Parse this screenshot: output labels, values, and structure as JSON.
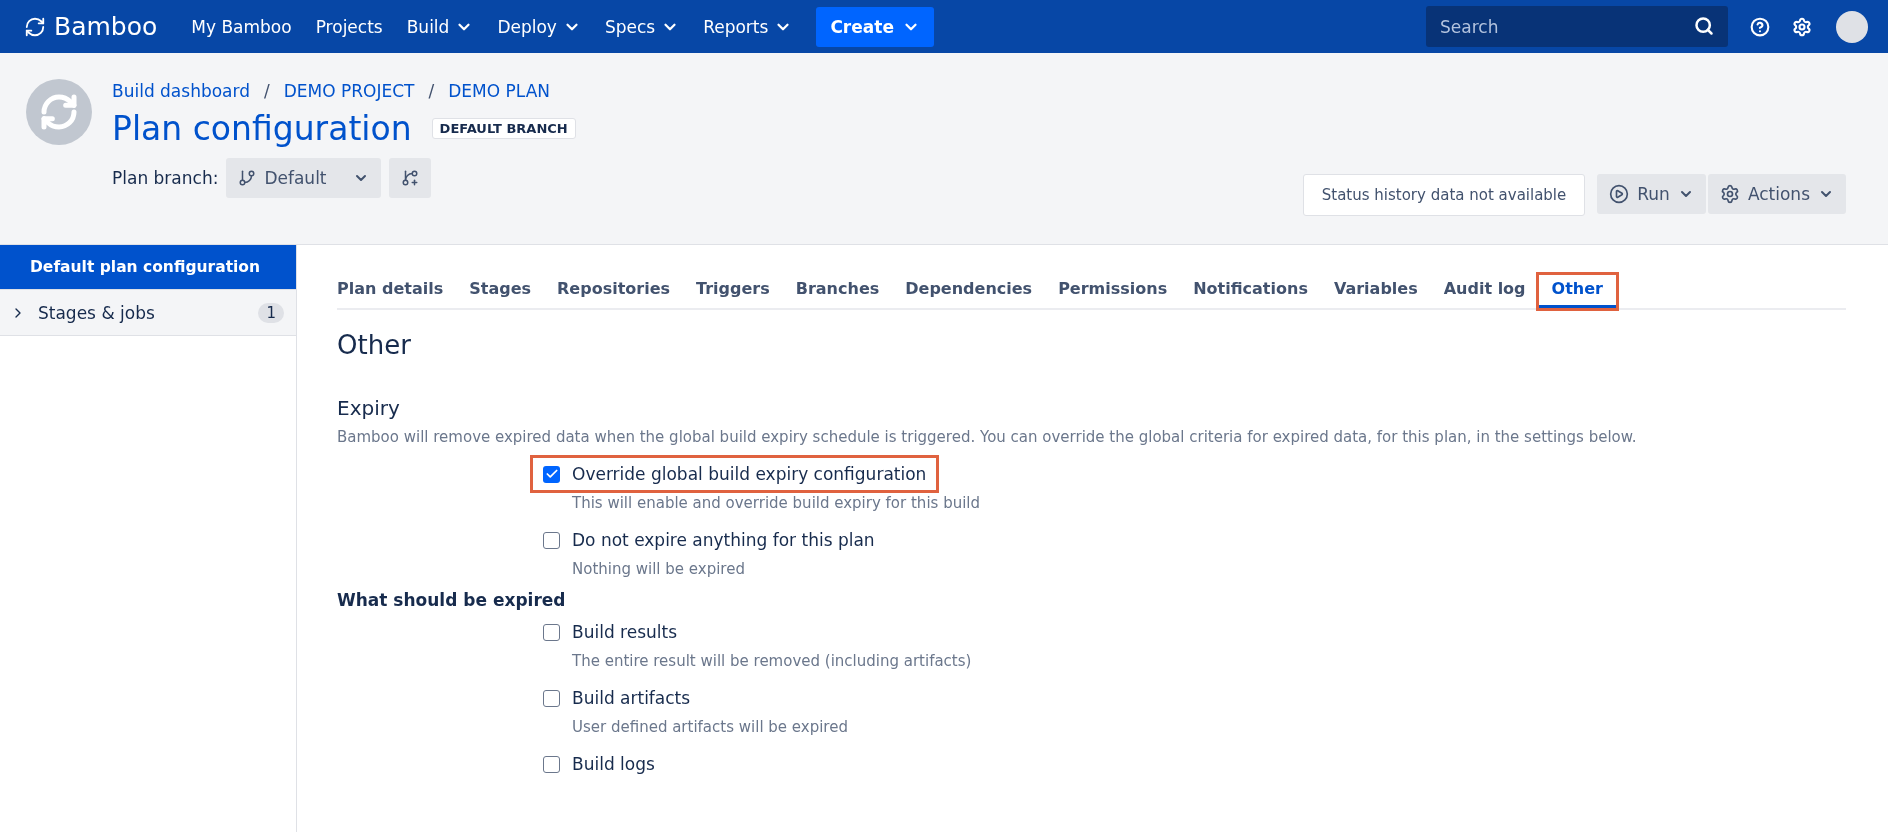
{
  "nav": {
    "brand": "Bamboo",
    "items": [
      {
        "label": "My Bamboo",
        "dropdown": false
      },
      {
        "label": "Projects",
        "dropdown": false
      },
      {
        "label": "Build",
        "dropdown": true
      },
      {
        "label": "Deploy",
        "dropdown": true
      },
      {
        "label": "Specs",
        "dropdown": true
      },
      {
        "label": "Reports",
        "dropdown": true
      }
    ],
    "create": "Create",
    "search": {
      "placeholder": "Search"
    }
  },
  "header": {
    "breadcrumbs": [
      "Build dashboard",
      "DEMO PROJECT",
      "DEMO PLAN"
    ],
    "separator": "/",
    "title": "Plan configuration",
    "badge": "DEFAULT BRANCH",
    "branch_label": "Plan branch:",
    "branch_value": "Default",
    "status": "Status history data not available",
    "run": "Run",
    "actions": "Actions"
  },
  "sidebar": {
    "items": [
      {
        "label": "Default plan configuration",
        "selected": true
      },
      {
        "label": "Stages & jobs",
        "selected": false,
        "count": "1"
      }
    ]
  },
  "tabs": [
    {
      "label": "Plan details",
      "selected": false,
      "highlighted": false
    },
    {
      "label": "Stages",
      "selected": false,
      "highlighted": false
    },
    {
      "label": "Repositories",
      "selected": false,
      "highlighted": false
    },
    {
      "label": "Triggers",
      "selected": false,
      "highlighted": false
    },
    {
      "label": "Branches",
      "selected": false,
      "highlighted": false
    },
    {
      "label": "Dependencies",
      "selected": false,
      "highlighted": false
    },
    {
      "label": "Permissions",
      "selected": false,
      "highlighted": false
    },
    {
      "label": "Notifications",
      "selected": false,
      "highlighted": false
    },
    {
      "label": "Variables",
      "selected": false,
      "highlighted": false
    },
    {
      "label": "Audit log",
      "selected": false,
      "highlighted": false
    },
    {
      "label": "Other",
      "selected": true,
      "highlighted": true
    }
  ],
  "page_title": "Other",
  "expiry": {
    "title": "Expiry",
    "description": "Bamboo will remove expired data when the global build expiry schedule is triggered. You can override the global criteria for expired data, for this plan, in the settings below.",
    "options": [
      {
        "label": "Override global build expiry configuration",
        "hint": "This will enable and override build expiry for this build",
        "checked": true,
        "highlighted": true
      },
      {
        "label": "Do not expire anything for this plan",
        "hint": "Nothing will be expired",
        "checked": false,
        "highlighted": false
      }
    ]
  },
  "expired": {
    "title": "What should be expired",
    "options": [
      {
        "label": "Build results",
        "hint": "The entire result will be removed (including artifacts)",
        "checked": false
      },
      {
        "label": "Build artifacts",
        "hint": "User defined artifacts will be expired",
        "checked": false
      },
      {
        "label": "Build logs",
        "checked": false
      }
    ]
  }
}
